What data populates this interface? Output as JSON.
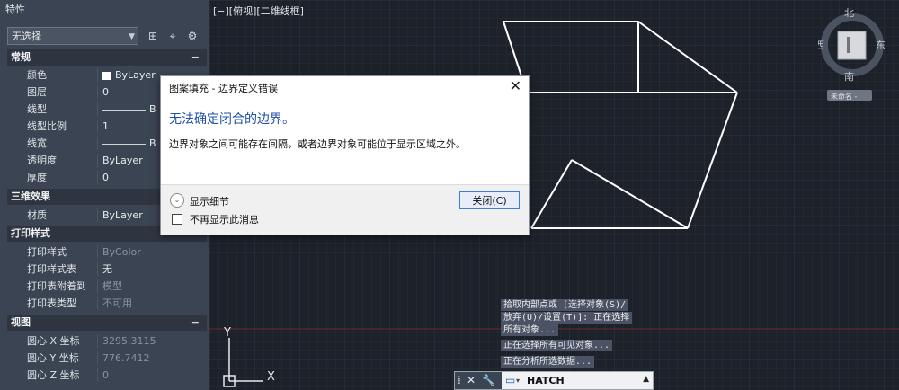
{
  "palette": {
    "title": "特性",
    "selection": "无选择",
    "sections": {
      "general": "常规",
      "threed": "三维效果",
      "plot": "打印样式",
      "view": "视图"
    },
    "general_rows": [
      {
        "label": "颜色",
        "value": "ByLayer"
      },
      {
        "label": "图层",
        "value": "0"
      },
      {
        "label": "线型",
        "value": "B"
      },
      {
        "label": "线型比例",
        "value": "1"
      },
      {
        "label": "线宽",
        "value": "B"
      },
      {
        "label": "透明度",
        "value": "ByLayer"
      },
      {
        "label": "厚度",
        "value": "0"
      }
    ],
    "threed_rows": [
      {
        "label": "材质",
        "value": "ByLayer"
      }
    ],
    "plot_rows": [
      {
        "label": "打印样式",
        "value": "ByColor"
      },
      {
        "label": "打印样式表",
        "value": "无"
      },
      {
        "label": "打印表附着到",
        "value": "模型"
      },
      {
        "label": "打印表类型",
        "value": "不可用"
      }
    ],
    "view_rows": [
      {
        "label": "圆心 X 坐标",
        "value": "3295.3115"
      },
      {
        "label": "圆心 Y 坐标",
        "value": "776.7412"
      },
      {
        "label": "圆心 Z 坐标",
        "value": "0"
      }
    ]
  },
  "viewport": {
    "label": "[−][俯视][二维线框]",
    "axis_y": "Y",
    "axis_x": "X"
  },
  "compass": {
    "north": "北",
    "south": "南",
    "east": "东",
    "west": "西",
    "wcs": "未命名 -"
  },
  "dialog": {
    "title": "图案填充 - 边界定义错误",
    "heading": "无法确定闭合的边界。",
    "body": "边界对象之间可能存在间隔，或者边界对象可能位于显示区域之外。",
    "details": "显示细节",
    "close_button": "关闭(C)",
    "dont_show": "不再显示此消息"
  },
  "command": {
    "history": [
      "拾取内部点或 [选择对象(S)/",
      "放弃(U)/设置(T)]: 正在选择",
      "所有对象...",
      "正在选择所有可见对象...",
      "正在分析所选数据..."
    ],
    "input": "HATCH"
  }
}
